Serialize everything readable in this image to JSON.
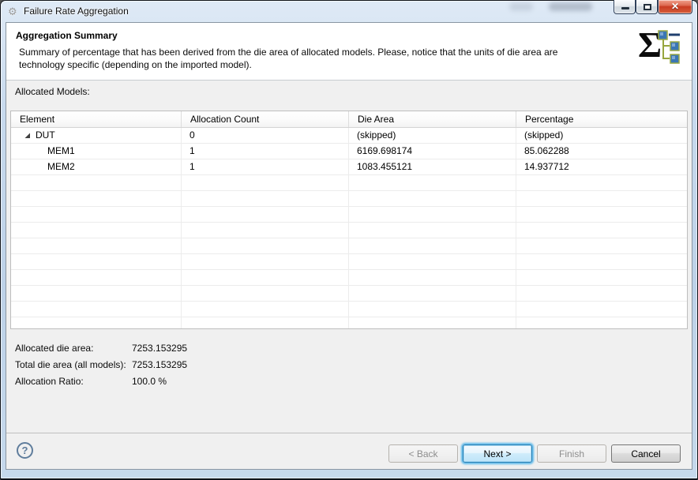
{
  "window": {
    "title": "Failure Rate Aggregation",
    "controls": {
      "minimize": "minimize",
      "maximize": "maximize",
      "close": "close"
    }
  },
  "header": {
    "title": "Aggregation Summary",
    "description": "Summary of percentage that has been derived from the die area of allocated models. Please, notice that the units of die area are technology specific (depending on the imported model).",
    "icon": "sigma-hierarchy-icon"
  },
  "content": {
    "allocated_models_label": "Allocated Models:",
    "table": {
      "columns": [
        "Element",
        "Allocation Count",
        "Die Area",
        "Percentage"
      ],
      "rows": [
        {
          "element": "DUT",
          "allocation_count": "0",
          "die_area": "(skipped)",
          "percentage": "(skipped)",
          "level": 0,
          "expanded": true
        },
        {
          "element": "MEM1",
          "allocation_count": "1",
          "die_area": "6169.698174",
          "percentage": "85.062288",
          "level": 1
        },
        {
          "element": "MEM2",
          "allocation_count": "1",
          "die_area": "1083.455121",
          "percentage": "14.937712",
          "level": 1
        }
      ],
      "empty_row_count": 10
    },
    "summary": [
      {
        "label": "Allocated die area:",
        "value": "7253.153295"
      },
      {
        "label": "Total die area (all models):",
        "value": "7253.153295"
      },
      {
        "label": "Allocation Ratio:",
        "value": "100.0 %"
      }
    ]
  },
  "footer": {
    "help_label": "?",
    "buttons": [
      {
        "label": "< Back",
        "enabled": false
      },
      {
        "label": "Next >",
        "enabled": true,
        "default": true
      },
      {
        "label": "Finish",
        "enabled": false
      },
      {
        "label": "Cancel",
        "enabled": true
      }
    ]
  },
  "colors": {
    "focus_accent": "#3faee9",
    "close_button": "#c93b22",
    "help_icon": "#5f7d9c",
    "tree_square_blue": "#3a76b4",
    "tree_connector_olive": "#97a53d"
  }
}
